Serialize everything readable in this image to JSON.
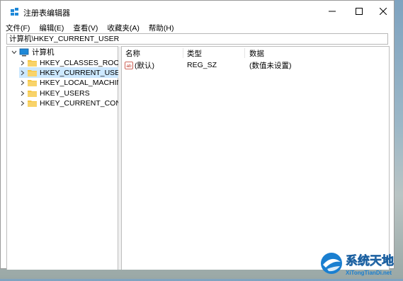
{
  "window": {
    "title": "注册表编辑器"
  },
  "menu": [
    "文件(F)",
    "编辑(E)",
    "查看(V)",
    "收藏夹(A)",
    "帮助(H)"
  ],
  "address_bar": {
    "value": "计算机\\HKEY_CURRENT_USER"
  },
  "tree": {
    "root": "计算机",
    "items": [
      {
        "label": "HKEY_CLASSES_ROOT",
        "selected": false
      },
      {
        "label": "HKEY_CURRENT_USER",
        "selected": true
      },
      {
        "label": "HKEY_LOCAL_MACHINE",
        "selected": false
      },
      {
        "label": "HKEY_USERS",
        "selected": false
      },
      {
        "label": "HKEY_CURRENT_CONFIG",
        "selected": false
      }
    ]
  },
  "list": {
    "columns": [
      "名称",
      "类型",
      "数据"
    ],
    "rows": [
      {
        "name": "(默认)",
        "type": "REG_SZ",
        "data": "(数值未设置)"
      }
    ]
  },
  "watermark": {
    "title": "系统天地",
    "url": "XiTongTianDi.net"
  },
  "colors": {
    "selection": "#cce8ff",
    "folder": "#f5c542",
    "computer_icon": "#1e88d8"
  }
}
